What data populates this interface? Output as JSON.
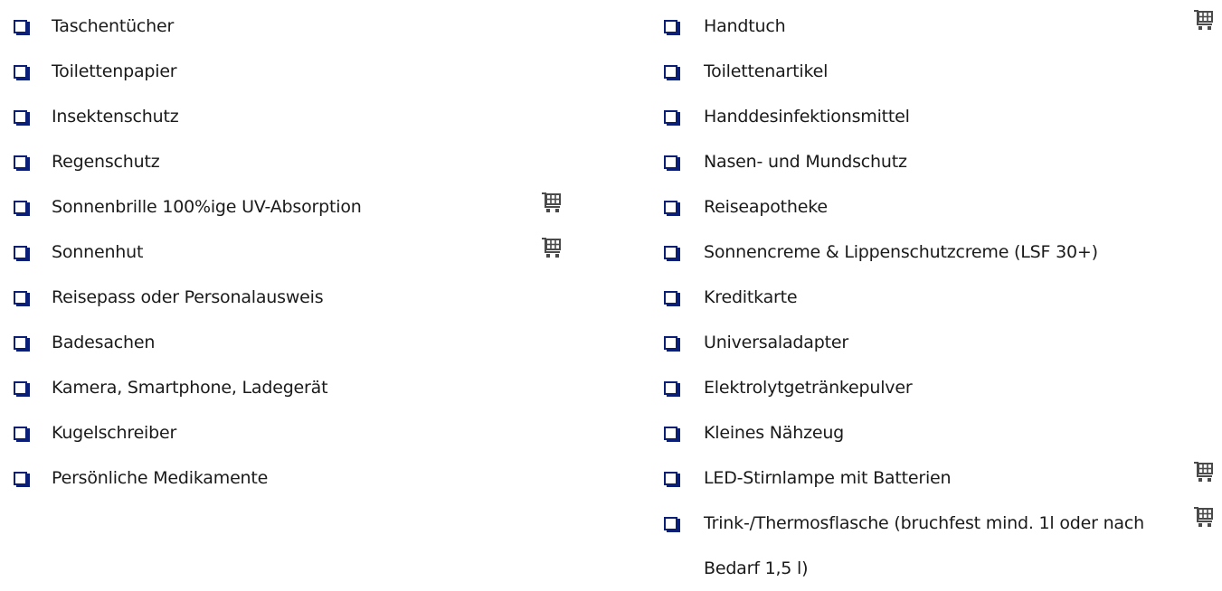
{
  "checklist": {
    "left": [
      {
        "label": "Taschentücher",
        "cart": false
      },
      {
        "label": "Toilettenpapier",
        "cart": false
      },
      {
        "label": "Insektenschutz",
        "cart": false
      },
      {
        "label": "Regenschutz",
        "cart": false
      },
      {
        "label": "Sonnenbrille 100%ige UV-Absorption",
        "cart": true
      },
      {
        "label": "Sonnenhut",
        "cart": true
      },
      {
        "label": "Reisepass oder Personalausweis",
        "cart": false
      },
      {
        "label": "Badesachen",
        "cart": false
      },
      {
        "label": "Kamera, Smartphone, Ladegerät",
        "cart": false
      },
      {
        "label": "Kugelschreiber",
        "cart": false
      },
      {
        "label": "Persönliche Medikamente",
        "cart": false
      }
    ],
    "right": [
      {
        "label": "Handtuch",
        "cart": true
      },
      {
        "label": "Toilettenartikel",
        "cart": false
      },
      {
        "label": "Handdesinfektionsmittel",
        "cart": false
      },
      {
        "label": "Nasen- und Mundschutz",
        "cart": false
      },
      {
        "label": "Reiseapotheke",
        "cart": false
      },
      {
        "label": "Sonnencreme & Lippenschutzcreme (LSF 30+)",
        "cart": false
      },
      {
        "label": "Kreditkarte",
        "cart": false
      },
      {
        "label": "Universaladapter",
        "cart": false
      },
      {
        "label": "Elektrolytgetränkepulver",
        "cart": false
      },
      {
        "label": "Kleines Nähzeug",
        "cart": false
      },
      {
        "label": "LED-Stirnlampe mit Batterien",
        "cart": true
      },
      {
        "label": "Trink-/Thermosflasche (bruchfest mind. 1l oder nach Bedarf 1,5 l)",
        "cart": true,
        "wrap": true
      }
    ]
  },
  "colors": {
    "checkbox": "#0c1f77",
    "cart_icon": "#4a4a4a",
    "text": "#1a1a1a"
  },
  "icons": {
    "checkbox": "checkbox-icon",
    "cart": "shopping-cart-icon"
  }
}
